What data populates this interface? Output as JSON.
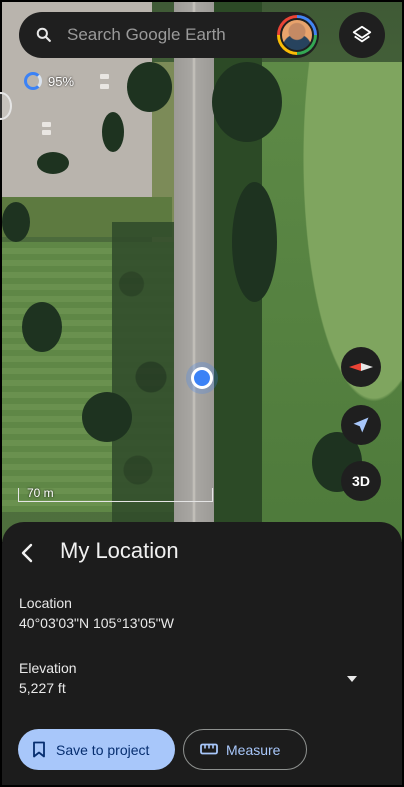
{
  "search": {
    "placeholder": "Search Google Earth"
  },
  "loading": {
    "percent_label": "95%",
    "progress": 0.95
  },
  "map": {
    "scale_label": "70 m"
  },
  "controls": {
    "btn_3d_label": "3D"
  },
  "icons": {
    "search": "search-icon",
    "layers": "layers-icon",
    "compass": "compass-icon",
    "my_location": "navigation-arrow-icon",
    "back": "back-arrow-icon",
    "expand": "dropdown-triangle-icon",
    "save": "bookmark-icon",
    "measure": "ruler-icon"
  },
  "sheet": {
    "title": "My Location",
    "location_label": "Location",
    "location_value": "40°03'03\"N 105°13'05\"W",
    "elevation_label": "Elevation",
    "elevation_value": "5,227 ft",
    "save_label": "Save to project",
    "measure_label": "Measure"
  },
  "colors": {
    "accent_blue": "#3b82f6",
    "sheet_bg": "#1c1c1c",
    "save_button_bg": "#a8c7fa",
    "measure_text": "#a8c7fa"
  }
}
